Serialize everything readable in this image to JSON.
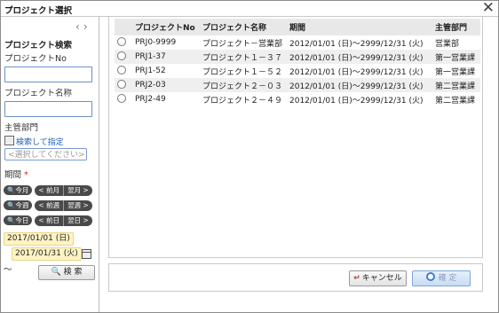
{
  "window": {
    "title": "プロジェクト選択",
    "close_icon": "close-icon"
  },
  "sidebar": {
    "nav_prev": "‹",
    "nav_next": "›",
    "heading": "プロジェクト検索",
    "project_no_label": "プロジェクトNo",
    "project_no_value": "",
    "project_name_label": "プロジェクト名称",
    "project_name_value": "",
    "dept_label": "主管部門",
    "dept_search_link": "検索して指定",
    "dept_placeholder": "<選択してください>",
    "period_label": "期間",
    "required_mark": "*",
    "rows": [
      {
        "main": "今月",
        "prev": "< 前月",
        "next": "翌月 >"
      },
      {
        "main": "今週",
        "prev": "< 前週",
        "next": "翌週 >"
      },
      {
        "main": "今日",
        "prev": "< 前日",
        "next": "翌日 >"
      }
    ],
    "date_from": "2017/01/01 (日)",
    "tilde": "〜",
    "date_to": "2017/01/31 (火)",
    "search_button": "検 索"
  },
  "table": {
    "headers": [
      "プロジェクトNo",
      "プロジェクト名称",
      "期間",
      "主管部門"
    ],
    "rows": [
      {
        "no": "PRJ0-9999",
        "name": "プロジェクト－営業部",
        "period": "2012/01/01 (日)〜2999/12/31 (火)",
        "dept": "営業部"
      },
      {
        "no": "PRJ1-37",
        "name": "プロジェクト１－３７",
        "period": "2012/01/01 (日)〜2999/12/31 (火)",
        "dept": "第一営業課"
      },
      {
        "no": "PRJ1-52",
        "name": "プロジェクト１－５２",
        "period": "2012/01/01 (日)〜2999/12/31 (火)",
        "dept": "第一営業課"
      },
      {
        "no": "PRJ2-03",
        "name": "プロジェクト２－０３",
        "period": "2012/01/01 (日)〜2999/12/31 (火)",
        "dept": "第二営業課"
      },
      {
        "no": "PRJ2-49",
        "name": "プロジェクト２－４９",
        "period": "2012/01/01 (日)〜2999/12/31 (火)",
        "dept": "第二営業課"
      }
    ]
  },
  "footer": {
    "cancel_label": "キャンセル",
    "confirm_label": "確 定"
  }
}
